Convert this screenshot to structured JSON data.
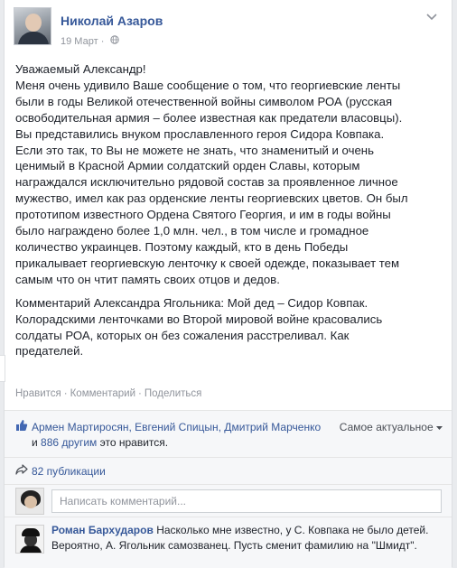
{
  "post": {
    "author": "Николай Азаров",
    "date": "19 Март",
    "privacy_icon": "globe-icon",
    "menu_icon": "chevron-down-icon",
    "body": [
      "Уважаемый Александр!",
      "Меня очень удивило Ваше сообщение о том, что георгиевские ленты",
      "были в годы Великой отечественной войны символом РОА (русская",
      "освободительная армия – более известная как предатели власовцы).",
      "Вы представились внуком прославленного героя Сидора Ковпака.",
      "Если это так, то Вы не можете не знать, что знаменитый и очень",
      "ценимый в Красной Армии солдатский орден Славы, которым",
      "награждался исключительно рядовой состав за проявленное личное",
      "мужество, имел как раз орденские ленты георгиевских цветов. Он был",
      "прототипом известного Ордена Святого Георгия, и им в годы войны",
      "было награждено более 1,0 млн. чел., в том числе и громадное",
      "количество украинцев. Поэтому каждый, кто в день Победы",
      "прикалывает георгиевскую ленточку к своей одежде, показывает тем",
      "самым что он чтит память своих отцов и дедов."
    ],
    "body2": [
      "Комментарий Александра Ягольника: Мой дед – Сидор Ковпак.",
      "Колорадскими ленточками во Второй мировой войне красовались",
      "солдаты РОА, которых он без сожаления расстреливал. Как",
      "предателей."
    ]
  },
  "actions": {
    "like": "Нравится",
    "comment": "Комментарий",
    "share": "Поделиться",
    "separator": "·"
  },
  "likes": {
    "icon": "thumbs-up-icon",
    "names": "Армен Мартиросян, Евгений Спицын, Дмитрий Марченко",
    "and": " и ",
    "others": "886 другим",
    "suffix": " это нравится.",
    "sort_label": "Самое актуальное",
    "sort_icon": "caret-down-icon"
  },
  "shares": {
    "icon": "share-arrow-icon",
    "count_label": "82 публикации"
  },
  "composer": {
    "placeholder": "Написать комментарий..."
  },
  "comment": {
    "author": "Роман Бархударов",
    "text": " Насколько мне известно, у С. Ковпака не было детей. Вероятно, А. Ягольник самозванец. Пусть сменит фамилию на \"Шмидт\"."
  },
  "colors": {
    "link": "#365899",
    "text": "#1d2129",
    "muted": "#90949c",
    "panel": "#f6f7f9"
  }
}
